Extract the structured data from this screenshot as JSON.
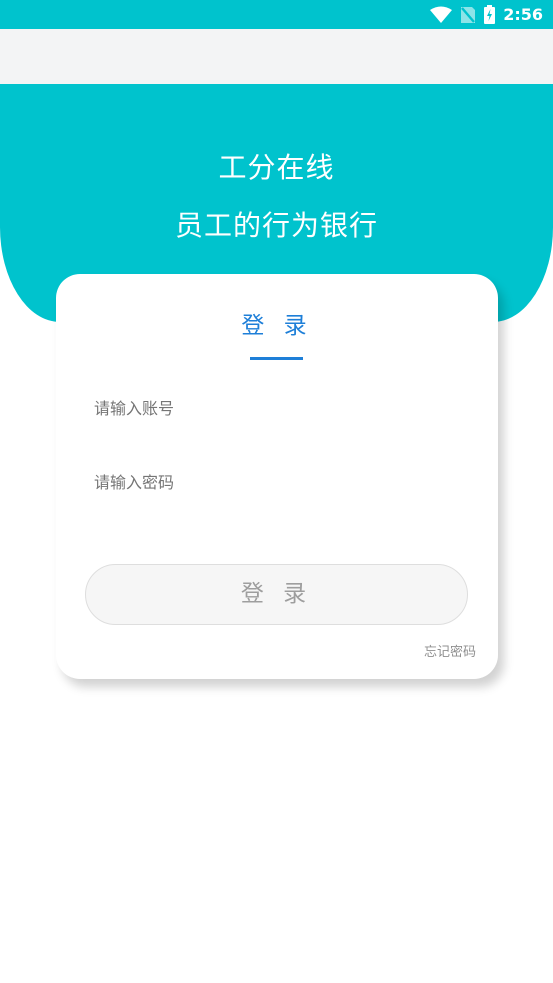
{
  "status_bar": {
    "time": "2:56",
    "icons": [
      "wifi-icon",
      "no-sim-icon",
      "battery-charging-icon"
    ],
    "background": "#00c3cd"
  },
  "hero": {
    "title": "工分在线",
    "subtitle": "员工的行为银行",
    "background": "#00c3cd"
  },
  "login_card": {
    "title": "登 录",
    "account_placeholder": "请输入账号",
    "password_placeholder": "请输入密码",
    "login_button_label": "登 录",
    "forgot_password_label": "忘记密码",
    "accent": "#1e7fd8"
  }
}
